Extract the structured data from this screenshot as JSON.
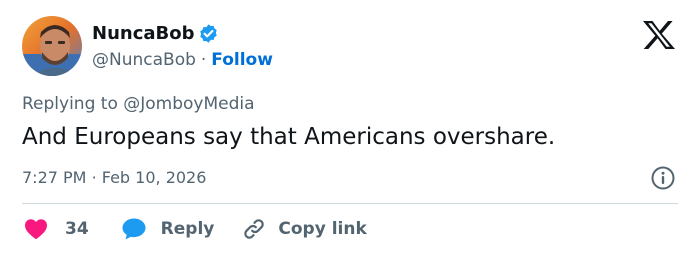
{
  "author": {
    "display_name": "NuncaBob",
    "handle": "@NuncaBob",
    "separator": "·",
    "follow_label": "Follow",
    "verified_color": "#1d9bf0"
  },
  "reply_to": {
    "prefix": "Replying to ",
    "mention": "@JomboyMedia"
  },
  "tweet": {
    "text": "And Europeans say that Americans overshare.",
    "time": "7:27 PM",
    "separator": "·",
    "date": "Feb 10, 2026"
  },
  "actions": {
    "like_count": "34",
    "reply_label": "Reply",
    "copy_label": "Copy link",
    "like_color": "#f91880",
    "reply_color": "#1d9bf0"
  },
  "icons": [
    "verified-badge-icon",
    "x-logo-icon",
    "info-icon",
    "heart-icon",
    "reply-bubble-icon",
    "link-icon"
  ]
}
